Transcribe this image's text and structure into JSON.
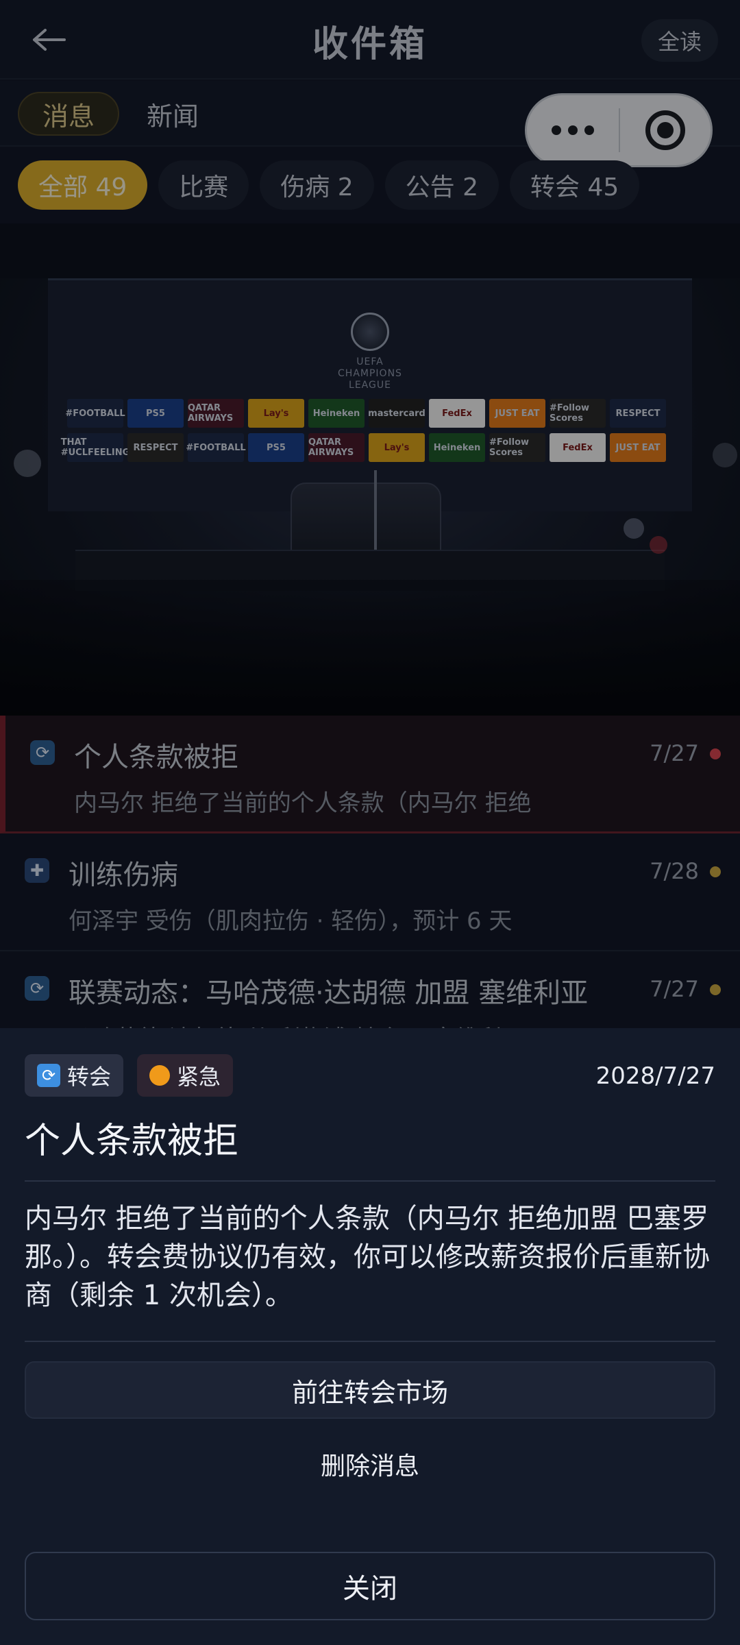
{
  "header": {
    "title": "收件箱",
    "read_all": "全读"
  },
  "tabs": [
    {
      "label": "消息",
      "active": true
    },
    {
      "label": "新闻",
      "active": false
    }
  ],
  "filters": [
    {
      "label": "全部 49",
      "active": true
    },
    {
      "label": "比赛",
      "active": false
    },
    {
      "label": "伤病 2",
      "active": false
    },
    {
      "label": "公告 2",
      "active": false
    },
    {
      "label": "转会 45",
      "active": false
    }
  ],
  "hero": {
    "logo_line1": "UEFA",
    "logo_line2": "CHAMPIONS",
    "logo_line3": "LEAGUE",
    "sponsors": [
      "#FOOTBALL",
      "PS5",
      "QATAR AIRWAYS",
      "Lay's",
      "Heineken",
      "mastercard",
      "FedEx",
      "JUST EAT",
      "#Follow Scores",
      "RESPECT",
      "THAT #UCLFEELING",
      "RESPECT",
      "#FOOTBALL",
      "PS5",
      "QATAR AIRWAYS",
      "Lay's",
      "Heineken",
      "#Follow Scores",
      "FedEx",
      "JUST EAT"
    ]
  },
  "messages": [
    {
      "icon": "transfer-icon",
      "title": "个人条款被拒",
      "date": "7/27",
      "preview": "内马尔 拒绝了当前的个人条款（内马尔 拒绝",
      "dot_color": "#d64550"
    },
    {
      "icon": "medical-icon",
      "title": "训练伤病",
      "date": "7/28",
      "preview": "何泽宇 受伤（肌肉拉伤 · 轻伤），预计 6 天",
      "dot_color": "#c9a641"
    },
    {
      "icon": "transfer-icon",
      "title": "联赛动态：马哈茂德·达胡德 加盟 塞维利亚",
      "date": "7/27",
      "preview": "马哈茂德·达胡德 从 利物浦 转会至 塞维利亚",
      "dot_color": "#c9a641"
    }
  ],
  "sheet": {
    "tag_transfer": "转会",
    "tag_urgent": "紧急",
    "date": "2028/7/27",
    "title": "个人条款被拒",
    "body": "内马尔 拒绝了当前的个人条款（内马尔 拒绝加盟 巴塞罗那。）。转会费协议仍有效，你可以修改薪资报价后重新协商（剩余 1 次机会）。",
    "primary_button": "前往转会市场",
    "delete_button": "删除消息",
    "close_button": "关闭"
  },
  "colors": {
    "accent": "#d8ac2c",
    "urgent": "#f09a1a",
    "transfer": "#3d8fe0",
    "unread_red": "#d64550"
  }
}
